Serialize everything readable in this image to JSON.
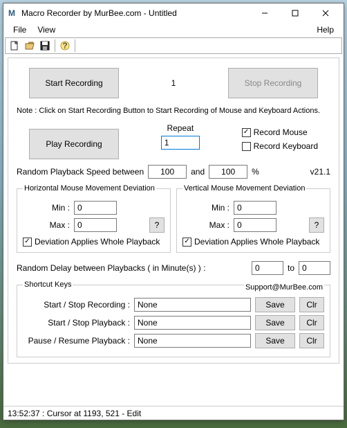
{
  "window": {
    "icon_letter": "M",
    "title": "Macro Recorder by MurBee.com - Untitled"
  },
  "menu": {
    "file": "File",
    "view": "View",
    "help": "Help"
  },
  "main": {
    "start_recording": "Start Recording",
    "counter": "1",
    "stop_recording": "Stop Recording",
    "note": "Note : Click on Start Recording Button to Start Recording of Mouse and Keyboard Actions.",
    "play_recording": "Play Recording",
    "repeat_label": "Repeat",
    "repeat_value": "1",
    "record_mouse": "Record Mouse",
    "record_keyboard": "Record Keyboard",
    "speed_label": "Random Playback Speed between",
    "speed_min": "100",
    "and": "and",
    "speed_max": "100",
    "percent": "%",
    "version": "v21.1"
  },
  "hdev": {
    "legend": "Horizontal Mouse Movement Deviation",
    "min_label": "Min :",
    "min_value": "0",
    "max_label": "Max :",
    "max_value": "0",
    "help": "?",
    "chk": "Deviation Applies Whole Playback"
  },
  "vdev": {
    "legend": "Vertical Mouse Movement Deviation",
    "min_label": "Min :",
    "min_value": "0",
    "max_label": "Max :",
    "max_value": "0",
    "help": "?",
    "chk": "Deviation Applies Whole Playback"
  },
  "delay": {
    "label": "Random Delay between Playbacks ( in Minute(s) ) :",
    "from": "0",
    "to_label": "to",
    "to": "0"
  },
  "shortcuts": {
    "legend": "Shortcut Keys",
    "support": "Support@MurBee.com",
    "rows": [
      {
        "label": "Start / Stop Recording :",
        "value": "None",
        "save": "Save",
        "clr": "Clr"
      },
      {
        "label": "Start / Stop Playback :",
        "value": "None",
        "save": "Save",
        "clr": "Clr"
      },
      {
        "label": "Pause / Resume  Playback :",
        "value": "None",
        "save": "Save",
        "clr": "Clr"
      }
    ]
  },
  "status": "13:52:37 : Cursor at 1193, 521 - Edit"
}
